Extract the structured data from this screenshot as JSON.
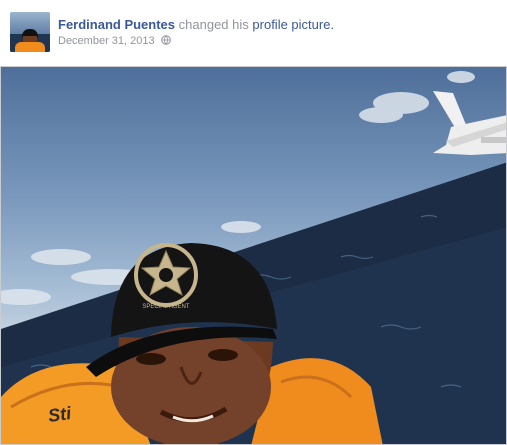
{
  "post": {
    "author_name": "Ferdinand Puentes",
    "action_text": "changed his",
    "action_link": "profile picture.",
    "date": "December 31, 2013",
    "privacy_icon": "globe-icon"
  },
  "photo": {
    "cap_badge_text": "SPECIAL AGENT",
    "vest_text": "Sti"
  },
  "colors": {
    "link": "#3b5998",
    "meta": "#90949c",
    "vest": "#f08b1d",
    "ocean": "#1b2c44"
  }
}
